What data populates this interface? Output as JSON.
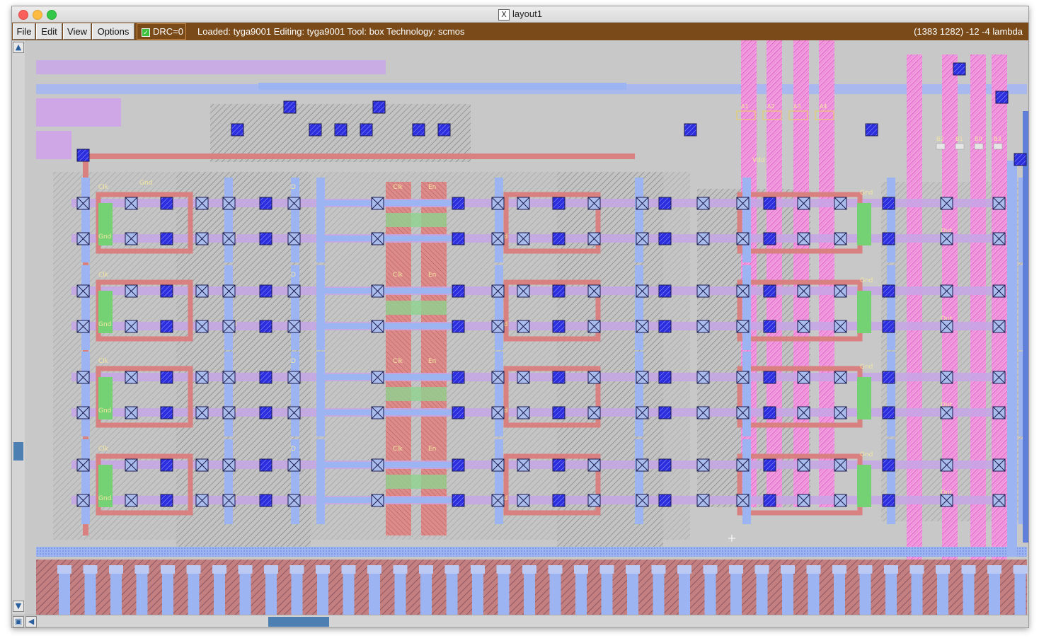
{
  "window": {
    "title": "layout1"
  },
  "menu": {
    "items": [
      "File",
      "Edit",
      "View",
      "Options"
    ]
  },
  "drc": {
    "label": "DRC=0",
    "checked": true
  },
  "status": {
    "text": "Loaded: tyga9001 Editing: tyga9001 Tool: box  Technology: scmos",
    "coords": "(1383 1282) -12 -4 lambda"
  },
  "colors": {
    "menubar": "#7a4a18",
    "canvas_bg": "#c8c8c8",
    "metal1": "#8fa8ef",
    "metal2": "#c8a4e0",
    "poly": "#d97e7e",
    "ndiff": "#6ed06e",
    "pselect": "#f28ad8",
    "contact": "#2b2bd8",
    "label": "#f3e7a0"
  },
  "icons": {
    "scroll_up": "arrow-up-icon",
    "scroll_down": "arrow-down-icon",
    "scroll_left": "arrow-left-icon",
    "corner": "box-icon"
  },
  "labels": {
    "gnd": "Gnd",
    "vdd": "Vdd",
    "clk": "Clk",
    "en": "En",
    "d": "D",
    "q": "Q",
    "qbar": "Qbar",
    "clkbar": "Clkbar",
    "out": "Out",
    "pin_a": [
      "A1",
      "A2",
      "A3",
      "A4"
    ],
    "pin_b": [
      "B2",
      "B1",
      "B0",
      "B3"
    ]
  }
}
